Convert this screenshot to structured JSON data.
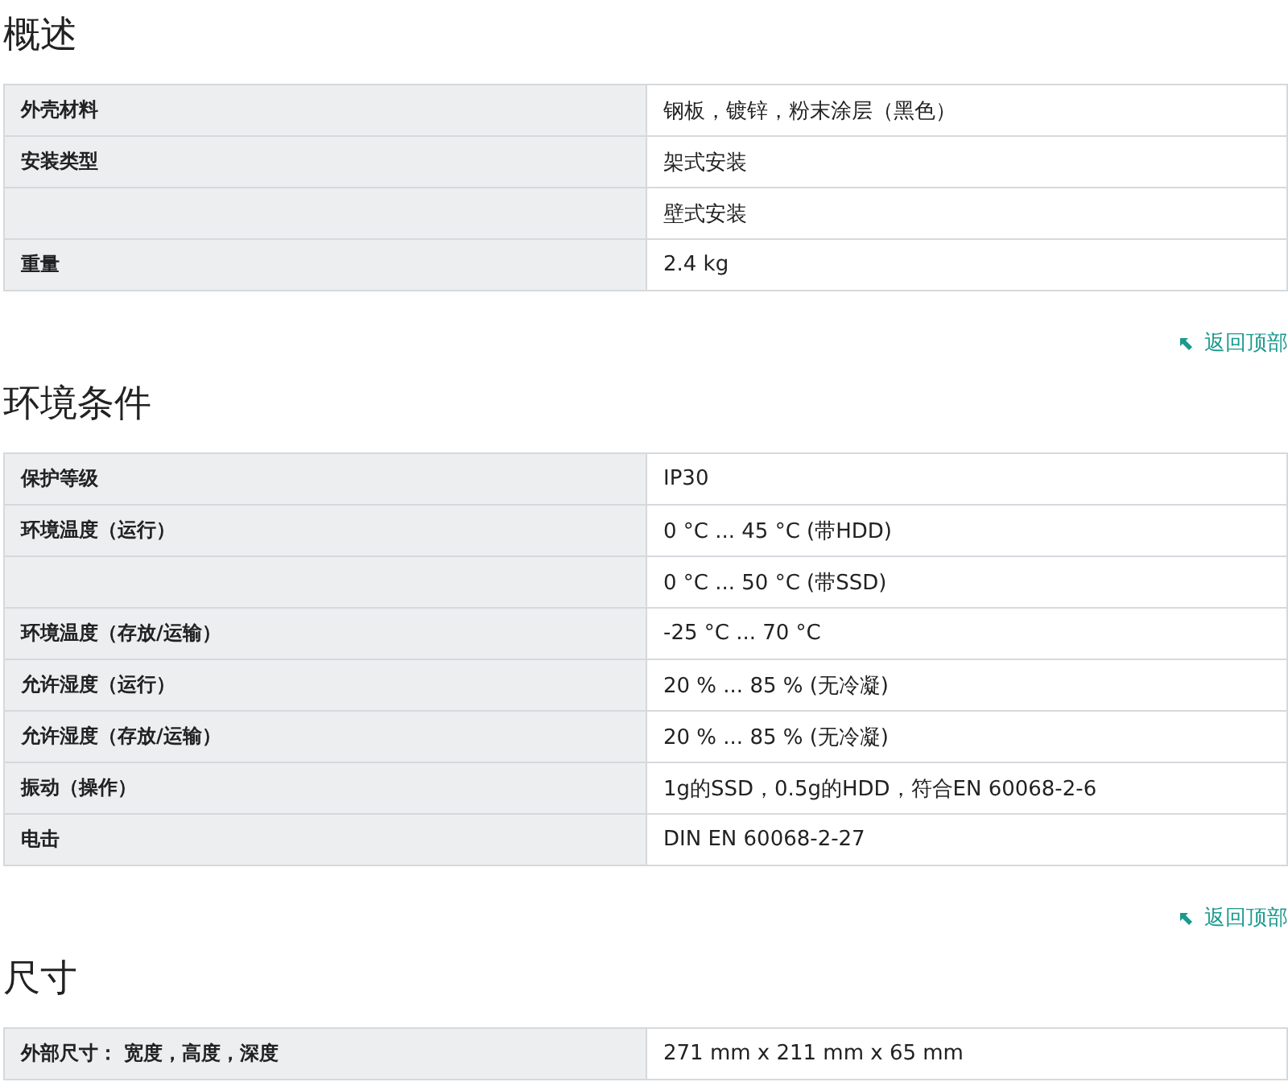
{
  "sections": [
    {
      "title": "概述",
      "rows": [
        {
          "label": "外壳材料",
          "value": "钢板，镀锌，粉末涂层（黑色）"
        },
        {
          "label": "安装类型",
          "value": "架式安装"
        },
        {
          "value": "壁式安装"
        },
        {
          "label": "重量",
          "value": "2.4 kg"
        }
      ],
      "back_link": "返回顶部"
    },
    {
      "title": "环境条件",
      "rows": [
        {
          "label": "保护等级",
          "value": "IP30"
        },
        {
          "label": "环境温度（运行）",
          "value": "0 °C ... 45 °C (带HDD)"
        },
        {
          "value": "0 °C ... 50 °C (带SSD)"
        },
        {
          "label": "环境温度（存放/运输）",
          "value": "-25 °C ... 70 °C"
        },
        {
          "label": "允许湿度（运行）",
          "value": "20 % ... 85 % (无冷凝)"
        },
        {
          "label": "允许湿度（存放/运输）",
          "value": "20 % ... 85 % (无冷凝)"
        },
        {
          "label": "振动（操作）",
          "value": "1g的SSD，0.5g的HDD，符合EN 60068-2-6"
        },
        {
          "label": "电击",
          "value": "DIN EN 60068-2-27"
        }
      ],
      "back_link": "返回顶部"
    },
    {
      "title": "尺寸",
      "rows": [
        {
          "label": "外部尺寸： 宽度，高度，深度",
          "value": "271 mm x 211 mm x 65 mm"
        }
      ]
    }
  ]
}
